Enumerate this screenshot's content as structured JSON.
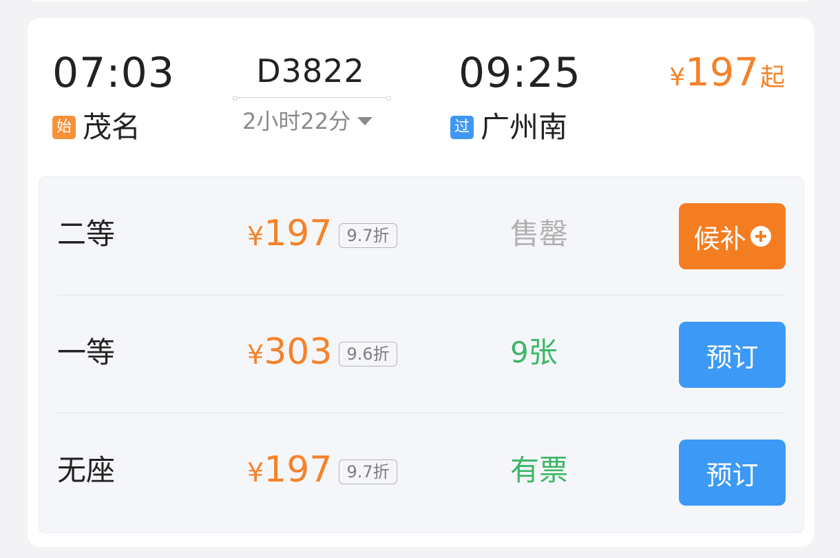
{
  "train": {
    "depart_time": "07:03",
    "depart_station_tag": "始",
    "depart_station": "茂名",
    "train_number": "D3822",
    "duration": "2小时22分",
    "arrive_time": "09:25",
    "arrive_station_tag": "过",
    "arrive_station": "广州南",
    "from_price": {
      "currency": "¥",
      "amount": "197",
      "suffix": "起"
    }
  },
  "seats": [
    {
      "class": "二等",
      "currency": "¥",
      "price": "197",
      "discount": "9.7折",
      "availability": "售罄",
      "availability_color": "#b0b0b0",
      "action_label": "候补",
      "action_icon": "plus-circle-icon",
      "action_color": "#f57d21"
    },
    {
      "class": "一等",
      "currency": "¥",
      "price": "303",
      "discount": "9.6折",
      "availability": "9张",
      "availability_color": "#3cb765",
      "action_label": "预订",
      "action_color": "#3c99f6"
    },
    {
      "class": "无座",
      "currency": "¥",
      "price": "197",
      "discount": "9.7折",
      "availability": "有票",
      "availability_color": "#3cb765",
      "action_label": "预订",
      "action_color": "#3c99f6"
    }
  ],
  "colors": {
    "accent_orange": "#f5822a",
    "accent_blue": "#3c99f6",
    "available_green": "#3cb765"
  }
}
